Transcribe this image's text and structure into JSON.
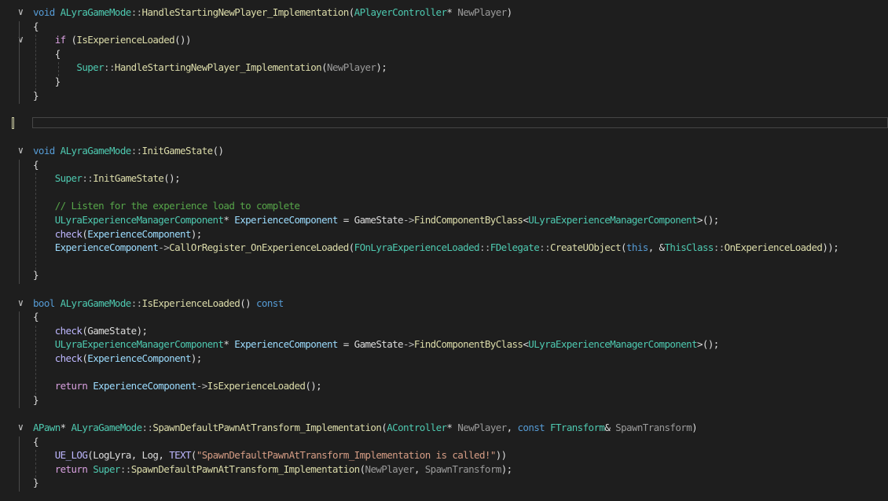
{
  "editor": {
    "fold_glyph": "∨",
    "lines": [
      {
        "fold": true,
        "tokens": [
          [
            "void ",
            "kw"
          ],
          [
            "ALyraGameMode",
            "type"
          ],
          [
            "::",
            "op"
          ],
          [
            "HandleStartingNewPlayer_Implementation",
            "fn"
          ],
          [
            "(",
            "plain"
          ],
          [
            "APlayerController",
            "type"
          ],
          [
            "* ",
            "plain"
          ],
          [
            "NewPlayer",
            "param"
          ],
          [
            ")",
            "plain"
          ]
        ]
      },
      {
        "tokens": [
          [
            "{",
            "plain"
          ]
        ]
      },
      {
        "fold": true,
        "tokens": [
          [
            "    if ",
            "ctl"
          ],
          [
            "(",
            "plain"
          ],
          [
            "IsExperienceLoaded",
            "fn"
          ],
          [
            "())",
            "plain"
          ]
        ]
      },
      {
        "tokens": [
          [
            "    {",
            "plain"
          ]
        ]
      },
      {
        "tokens": [
          [
            "        Super",
            "type"
          ],
          [
            "::",
            "op"
          ],
          [
            "HandleStartingNewPlayer_Implementation",
            "fn"
          ],
          [
            "(",
            "plain"
          ],
          [
            "NewPlayer",
            "param"
          ],
          [
            ");",
            "plain"
          ]
        ]
      },
      {
        "tokens": [
          [
            "    }",
            "plain"
          ]
        ]
      },
      {
        "tokens": [
          [
            "}",
            "plain"
          ]
        ]
      },
      {
        "tokens": []
      },
      {
        "tokens": []
      },
      {
        "tokens": []
      },
      {
        "fold": true,
        "tokens": [
          [
            "void ",
            "kw"
          ],
          [
            "ALyraGameMode",
            "type"
          ],
          [
            "::",
            "op"
          ],
          [
            "InitGameState",
            "fn"
          ],
          [
            "()",
            "plain"
          ]
        ]
      },
      {
        "tokens": [
          [
            "{",
            "plain"
          ]
        ]
      },
      {
        "tokens": [
          [
            "    Super",
            "type"
          ],
          [
            "::",
            "op"
          ],
          [
            "InitGameState",
            "fn"
          ],
          [
            "();",
            "plain"
          ]
        ]
      },
      {
        "tokens": []
      },
      {
        "tokens": [
          [
            "    // Listen for the experience load to complete",
            "cm"
          ]
        ]
      },
      {
        "tokens": [
          [
            "    ULyraExperienceManagerComponent",
            "type"
          ],
          [
            "* ",
            "plain"
          ],
          [
            "ExperienceComponent",
            "var"
          ],
          [
            " = ",
            "plain"
          ],
          [
            "GameState",
            "plain"
          ],
          [
            "->",
            "op"
          ],
          [
            "FindComponentByClass",
            "fn"
          ],
          [
            "<",
            "plain"
          ],
          [
            "ULyraExperienceManagerComponent",
            "type"
          ],
          [
            ">();",
            "plain"
          ]
        ]
      },
      {
        "tokens": [
          [
            "    check",
            "mac"
          ],
          [
            "(",
            "plain"
          ],
          [
            "ExperienceComponent",
            "var"
          ],
          [
            ");",
            "plain"
          ]
        ]
      },
      {
        "tokens": [
          [
            "    ExperienceComponent",
            "var"
          ],
          [
            "->",
            "op"
          ],
          [
            "CallOrRegister_OnExperienceLoaded",
            "fn"
          ],
          [
            "(",
            "plain"
          ],
          [
            "FOnLyraExperienceLoaded",
            "type"
          ],
          [
            "::",
            "op"
          ],
          [
            "FDelegate",
            "type"
          ],
          [
            "::",
            "op"
          ],
          [
            "CreateUObject",
            "fn"
          ],
          [
            "(",
            "plain"
          ],
          [
            "this",
            "kw"
          ],
          [
            ", &",
            "plain"
          ],
          [
            "ThisClass",
            "type"
          ],
          [
            "::",
            "op"
          ],
          [
            "OnExperienceLoaded",
            "fn"
          ],
          [
            "));",
            "plain"
          ]
        ]
      },
      {
        "tokens": []
      },
      {
        "tokens": [
          [
            "}",
            "plain"
          ]
        ]
      },
      {
        "tokens": []
      },
      {
        "fold": true,
        "tokens": [
          [
            "bool ",
            "kw"
          ],
          [
            "ALyraGameMode",
            "type"
          ],
          [
            "::",
            "op"
          ],
          [
            "IsExperienceLoaded",
            "fn"
          ],
          [
            "() ",
            "plain"
          ],
          [
            "const",
            "kw"
          ]
        ]
      },
      {
        "tokens": [
          [
            "{",
            "plain"
          ]
        ]
      },
      {
        "tokens": [
          [
            "    check",
            "mac"
          ],
          [
            "(",
            "plain"
          ],
          [
            "GameState",
            "plain"
          ],
          [
            ");",
            "plain"
          ]
        ]
      },
      {
        "tokens": [
          [
            "    ULyraExperienceManagerComponent",
            "type"
          ],
          [
            "* ",
            "plain"
          ],
          [
            "ExperienceComponent",
            "var"
          ],
          [
            " = ",
            "plain"
          ],
          [
            "GameState",
            "plain"
          ],
          [
            "->",
            "op"
          ],
          [
            "FindComponentByClass",
            "fn"
          ],
          [
            "<",
            "plain"
          ],
          [
            "ULyraExperienceManagerComponent",
            "type"
          ],
          [
            ">();",
            "plain"
          ]
        ]
      },
      {
        "tokens": [
          [
            "    check",
            "mac"
          ],
          [
            "(",
            "plain"
          ],
          [
            "ExperienceComponent",
            "var"
          ],
          [
            ");",
            "plain"
          ]
        ]
      },
      {
        "tokens": []
      },
      {
        "tokens": [
          [
            "    return ",
            "ctl"
          ],
          [
            "ExperienceComponent",
            "var"
          ],
          [
            "->",
            "op"
          ],
          [
            "IsExperienceLoaded",
            "fn"
          ],
          [
            "();",
            "plain"
          ]
        ]
      },
      {
        "tokens": [
          [
            "}",
            "plain"
          ]
        ]
      },
      {
        "tokens": []
      },
      {
        "fold": true,
        "tokens": [
          [
            "APawn",
            "type"
          ],
          [
            "* ",
            "plain"
          ],
          [
            "ALyraGameMode",
            "type"
          ],
          [
            "::",
            "op"
          ],
          [
            "SpawnDefaultPawnAtTransform_Implementation",
            "fn"
          ],
          [
            "(",
            "plain"
          ],
          [
            "AController",
            "type"
          ],
          [
            "* ",
            "plain"
          ],
          [
            "NewPlayer",
            "param"
          ],
          [
            ", ",
            "plain"
          ],
          [
            "const ",
            "kw"
          ],
          [
            "FTransform",
            "type"
          ],
          [
            "& ",
            "plain"
          ],
          [
            "SpawnTransform",
            "param"
          ],
          [
            ")",
            "plain"
          ]
        ]
      },
      {
        "tokens": [
          [
            "{",
            "plain"
          ]
        ]
      },
      {
        "tokens": [
          [
            "    UE_LOG",
            "mac"
          ],
          [
            "(",
            "plain"
          ],
          [
            "LogLyra",
            "plain"
          ],
          [
            ", ",
            "plain"
          ],
          [
            "Log",
            "plain"
          ],
          [
            ", ",
            "plain"
          ],
          [
            "TEXT",
            "mac"
          ],
          [
            "(",
            "plain"
          ],
          [
            "\"SpawnDefaultPawnAtTransform_Implementation is called!\"",
            "str"
          ],
          [
            "))",
            "plain"
          ]
        ]
      },
      {
        "tokens": [
          [
            "    return ",
            "ctl"
          ],
          [
            "Super",
            "type"
          ],
          [
            "::",
            "op"
          ],
          [
            "SpawnDefaultPawnAtTransform_Implementation",
            "fn"
          ],
          [
            "(",
            "plain"
          ],
          [
            "NewPlayer",
            "param"
          ],
          [
            ", ",
            "plain"
          ],
          [
            "SpawnTransform",
            "param"
          ],
          [
            ");",
            "plain"
          ]
        ]
      },
      {
        "tokens": [
          [
            "}",
            "plain"
          ]
        ]
      }
    ]
  }
}
